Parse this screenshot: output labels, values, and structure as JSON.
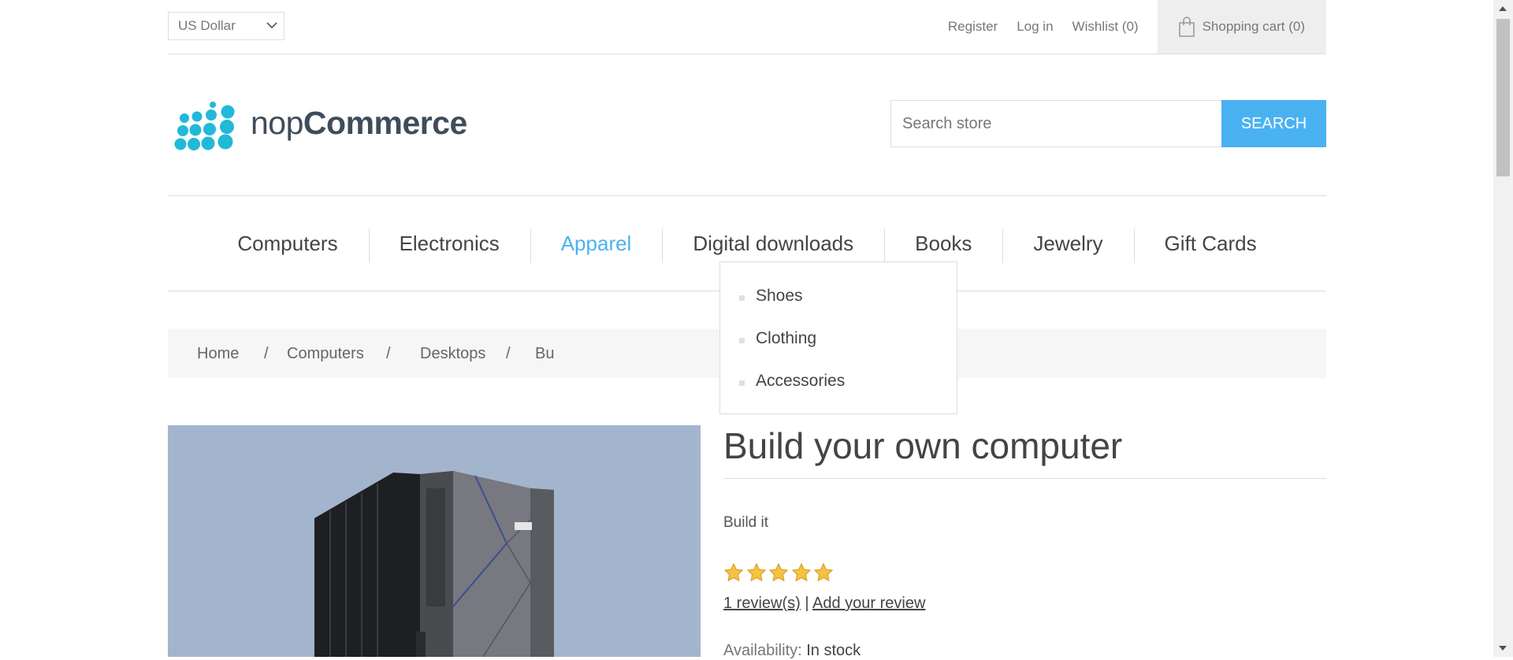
{
  "header": {
    "currency": "US Dollar",
    "links": {
      "register": "Register",
      "login": "Log in",
      "wishlist": "Wishlist (0)"
    },
    "cart": "Shopping cart (0)"
  },
  "logo": {
    "prefix": "nop",
    "suffix": "Commerce",
    "icon": "dots-logo-icon",
    "color": "#21b9d8"
  },
  "search": {
    "placeholder": "Search store",
    "button": "SEARCH"
  },
  "menu": {
    "items": [
      "Computers",
      "Electronics",
      "Apparel",
      "Digital downloads",
      "Books",
      "Jewelry",
      "Gift Cards"
    ],
    "active_index": 2,
    "active_color": "#4ab2f1"
  },
  "dropdown": {
    "items": [
      "Shoes",
      "Clothing",
      "Accessories"
    ]
  },
  "breadcrumb": {
    "items": [
      "Home",
      "Computers",
      "Desktops",
      "Bu"
    ],
    "separator": "/"
  },
  "product": {
    "name": "Build your own computer",
    "short_description": "Build it",
    "rating": 5,
    "rating_max": 5,
    "reviews_link": "1 review(s)",
    "separator": "|",
    "add_review_link": "Add your review",
    "availability_label": "Availability:",
    "availability_value": "In stock",
    "image_background": "#a3b4cd"
  }
}
